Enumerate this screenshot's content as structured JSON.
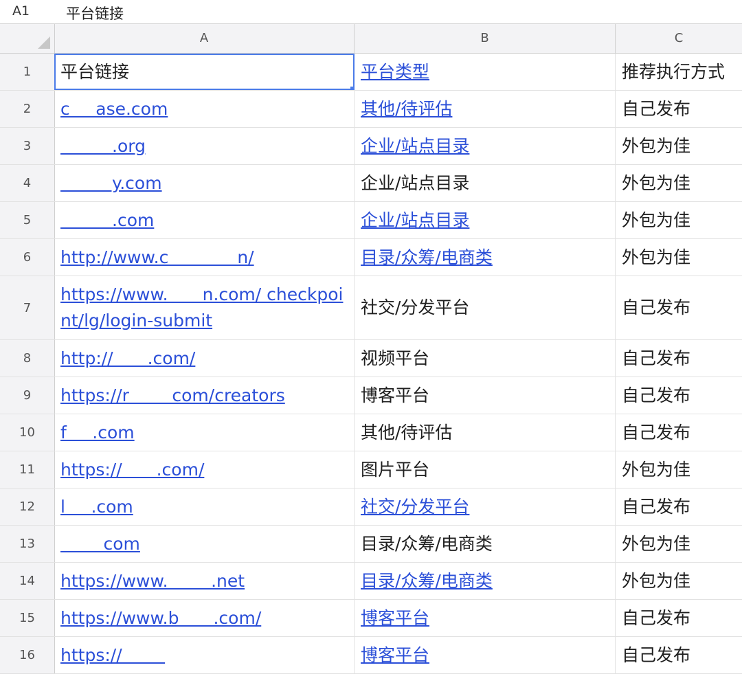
{
  "formula_bar": {
    "cell_ref": "A1",
    "content": "平台链接"
  },
  "columns": [
    "A",
    "B",
    "C"
  ],
  "rows": [
    {
      "num": "1",
      "a": "平台链接",
      "a_link": false,
      "b": "平台类型",
      "b_link": true,
      "c": "推荐执行方式"
    },
    {
      "num": "2",
      "a": "c   ase.com",
      "a_link": true,
      "b": "其他/待评估",
      "b_link": true,
      "c": "自己发布"
    },
    {
      "num": "3",
      "a": "      .org",
      "a_link": true,
      "b": "企业/站点目录",
      "b_link": true,
      "c": "外包为佳"
    },
    {
      "num": "4",
      "a": "      y.com",
      "a_link": true,
      "b": "企业/站点目录",
      "b_link": false,
      "c": "外包为佳"
    },
    {
      "num": "5",
      "a": "      .com",
      "a_link": true,
      "b": "企业/站点目录",
      "b_link": true,
      "c": "外包为佳"
    },
    {
      "num": "6",
      "a": "http://www.c        n/",
      "a_link": true,
      "b": "目录/众筹/电商类",
      "b_link": true,
      "c": "外包为佳"
    },
    {
      "num": "7",
      "a": "https://www.    n.com/ checkpoint/lg/login-submit",
      "a_link": true,
      "b": "社交/分发平台",
      "b_link": false,
      "c": "自己发布"
    },
    {
      "num": "8",
      "a": "http://    .com/",
      "a_link": true,
      "b": "视频平台",
      "b_link": false,
      "c": "自己发布"
    },
    {
      "num": "9",
      "a": "https://r     com/creators",
      "a_link": true,
      "b": "博客平台",
      "b_link": false,
      "c": "自己发布"
    },
    {
      "num": "10",
      "a": "f   .com",
      "a_link": true,
      "b": "其他/待评估",
      "b_link": false,
      "c": "自己发布"
    },
    {
      "num": "11",
      "a": "https://    .com/",
      "a_link": true,
      "b": "图片平台",
      "b_link": false,
      "c": "外包为佳"
    },
    {
      "num": "12",
      "a": "l   .com",
      "a_link": true,
      "b": "社交/分发平台",
      "b_link": true,
      "c": "自己发布"
    },
    {
      "num": "13",
      "a": "     com",
      "a_link": true,
      "b": "目录/众筹/电商类",
      "b_link": false,
      "c": "外包为佳"
    },
    {
      "num": "14",
      "a": "https://www.     .net",
      "a_link": true,
      "b": "目录/众筹/电商类",
      "b_link": true,
      "c": "外包为佳"
    },
    {
      "num": "15",
      "a": "https://www.b    .com/",
      "a_link": true,
      "b": "博客平台",
      "b_link": true,
      "c": "自己发布"
    },
    {
      "num": "16",
      "a": "https://     ",
      "a_link": true,
      "b": "博客平台",
      "b_link": true,
      "c": "自己发布"
    }
  ]
}
